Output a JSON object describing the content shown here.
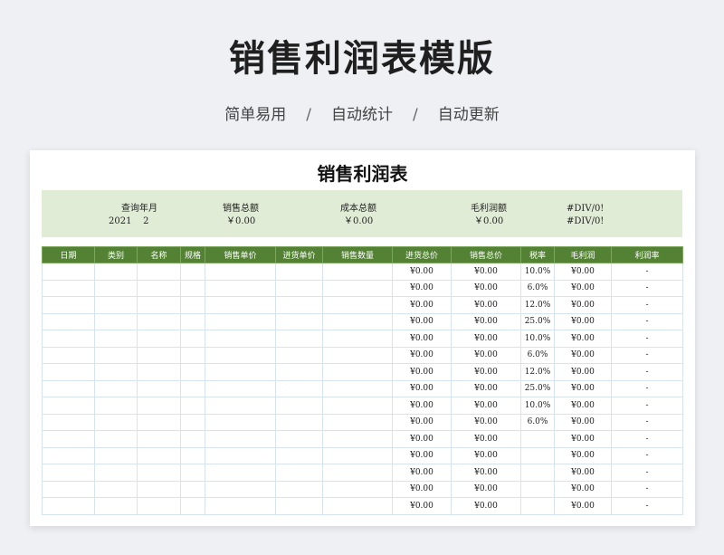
{
  "hero": {
    "title": "销售利润表模版",
    "features": [
      "简单易用",
      "自动统计",
      "自动更新"
    ],
    "separator": "/"
  },
  "sheet": {
    "title": "销售利润表",
    "summary": {
      "query": {
        "label": "查询年月",
        "year": "2021",
        "month": "2"
      },
      "sales_total": {
        "label": "销售总额",
        "value": "￥0.00"
      },
      "cost_total": {
        "label": "成本总额",
        "value": "￥0.00"
      },
      "gross_profit": {
        "label": "毛利润额",
        "value": "￥0.00"
      },
      "margin": {
        "label": "#DIV/0!",
        "value": "#DIV/0!"
      }
    },
    "columns": [
      "日期",
      "类别",
      "名称",
      "规格",
      "销售单价",
      "进货单价",
      "销售数量",
      "进货总价",
      "销售总价",
      "税率",
      "毛利润",
      "利润率"
    ],
    "rows": [
      {
        "purchase_total": "¥0.00",
        "sales_total": "¥0.00",
        "tax": "10.0%",
        "profit": "¥0.00",
        "margin": "-"
      },
      {
        "purchase_total": "¥0.00",
        "sales_total": "¥0.00",
        "tax": "6.0%",
        "profit": "¥0.00",
        "margin": "-"
      },
      {
        "purchase_total": "¥0.00",
        "sales_total": "¥0.00",
        "tax": "12.0%",
        "profit": "¥0.00",
        "margin": "-"
      },
      {
        "purchase_total": "¥0.00",
        "sales_total": "¥0.00",
        "tax": "25.0%",
        "profit": "¥0.00",
        "margin": "-"
      },
      {
        "purchase_total": "¥0.00",
        "sales_total": "¥0.00",
        "tax": "10.0%",
        "profit": "¥0.00",
        "margin": "-"
      },
      {
        "purchase_total": "¥0.00",
        "sales_total": "¥0.00",
        "tax": "6.0%",
        "profit": "¥0.00",
        "margin": "-"
      },
      {
        "purchase_total": "¥0.00",
        "sales_total": "¥0.00",
        "tax": "12.0%",
        "profit": "¥0.00",
        "margin": "-"
      },
      {
        "purchase_total": "¥0.00",
        "sales_total": "¥0.00",
        "tax": "25.0%",
        "profit": "¥0.00",
        "margin": "-"
      },
      {
        "purchase_total": "¥0.00",
        "sales_total": "¥0.00",
        "tax": "10.0%",
        "profit": "¥0.00",
        "margin": "-"
      },
      {
        "purchase_total": "¥0.00",
        "sales_total": "¥0.00",
        "tax": "6.0%",
        "profit": "¥0.00",
        "margin": "-"
      },
      {
        "purchase_total": "¥0.00",
        "sales_total": "¥0.00",
        "tax": "",
        "profit": "¥0.00",
        "margin": "-"
      },
      {
        "purchase_total": "¥0.00",
        "sales_total": "¥0.00",
        "tax": "",
        "profit": "¥0.00",
        "margin": "-"
      },
      {
        "purchase_total": "¥0.00",
        "sales_total": "¥0.00",
        "tax": "",
        "profit": "¥0.00",
        "margin": "-"
      },
      {
        "purchase_total": "¥0.00",
        "sales_total": "¥0.00",
        "tax": "",
        "profit": "¥0.00",
        "margin": "-"
      },
      {
        "purchase_total": "¥0.00",
        "sales_total": "¥0.00",
        "tax": "",
        "profit": "¥0.00",
        "margin": "-"
      }
    ],
    "colors": {
      "header_bg": "#548235",
      "summary_bg": "#e1ecd7",
      "grid_line": "#d7e3ee"
    }
  }
}
